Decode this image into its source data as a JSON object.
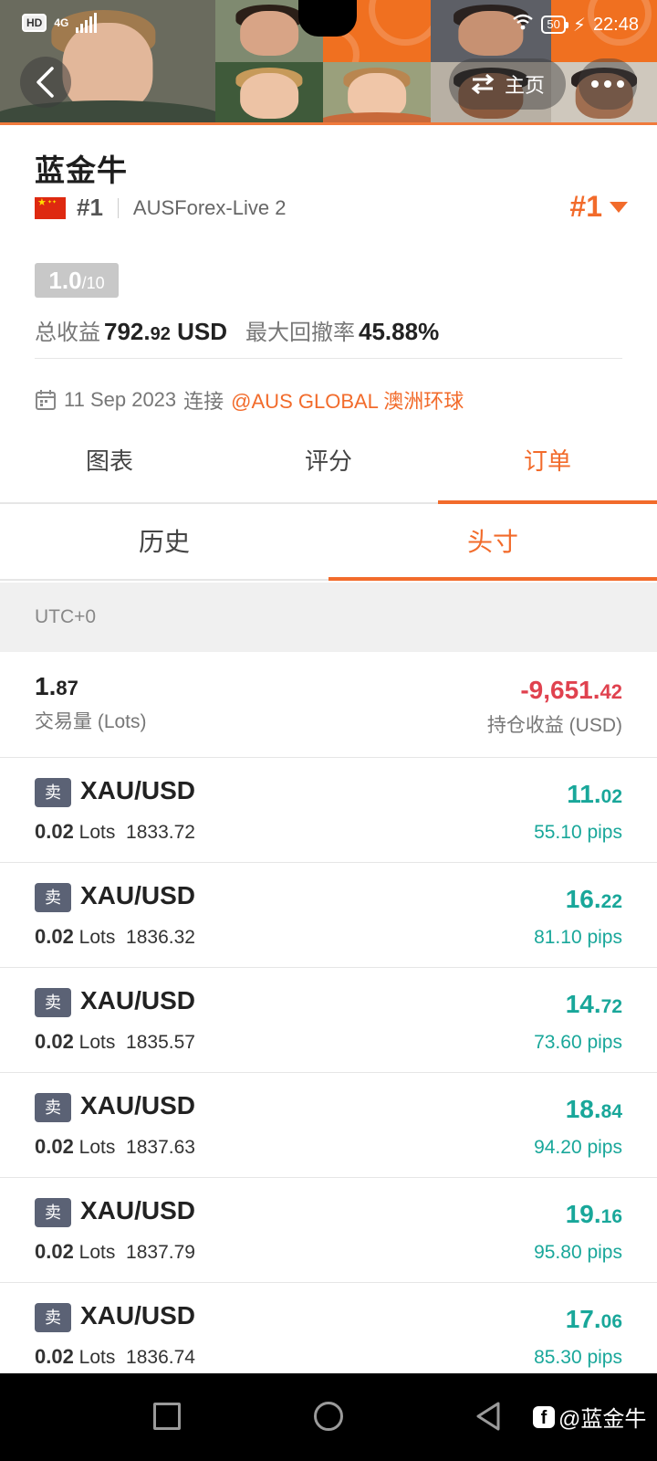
{
  "status_bar": {
    "hd": "HD",
    "network": "4G",
    "battery": "50",
    "time": "22:48"
  },
  "header": {
    "home_label": "主页"
  },
  "profile": {
    "name": "蓝金牛",
    "rank": "#1",
    "server": "AUSForex-Live 2",
    "rank_dropdown": "#1",
    "score_main": "1.0",
    "score_total": "/10",
    "total_profit_label": "总收益",
    "total_profit_int": "792.",
    "total_profit_dec": "92",
    "total_profit_unit": "USD",
    "max_drawdown_label": "最大回撤率",
    "max_drawdown": "45.88%",
    "connect_date": "11 Sep 2023",
    "connect_label": "连接",
    "broker": "@AUS GLOBAL 澳洲环球"
  },
  "tabs": [
    {
      "label": "图表"
    },
    {
      "label": "评分"
    },
    {
      "label": "订单"
    }
  ],
  "subtabs": [
    {
      "label": "历史"
    },
    {
      "label": "头寸"
    }
  ],
  "timezone": "UTC+0",
  "summary": {
    "volume_int": "1.",
    "volume_dec": "87",
    "volume_label": "交易量 (Lots)",
    "pl_int": "-9,651.",
    "pl_dec": "42",
    "pl_label": "持仓收益 (USD)"
  },
  "orders": [
    {
      "side": "卖",
      "symbol": "XAU/USD",
      "lots": "0.02",
      "lots_unit": "Lots",
      "price": "1833.72",
      "profit_int": "11.",
      "profit_dec": "02",
      "pips": "55.10 pips"
    },
    {
      "side": "卖",
      "symbol": "XAU/USD",
      "lots": "0.02",
      "lots_unit": "Lots",
      "price": "1836.32",
      "profit_int": "16.",
      "profit_dec": "22",
      "pips": "81.10 pips"
    },
    {
      "side": "卖",
      "symbol": "XAU/USD",
      "lots": "0.02",
      "lots_unit": "Lots",
      "price": "1835.57",
      "profit_int": "14.",
      "profit_dec": "72",
      "pips": "73.60 pips"
    },
    {
      "side": "卖",
      "symbol": "XAU/USD",
      "lots": "0.02",
      "lots_unit": "Lots",
      "price": "1837.63",
      "profit_int": "18.",
      "profit_dec": "84",
      "pips": "94.20 pips"
    },
    {
      "side": "卖",
      "symbol": "XAU/USD",
      "lots": "0.02",
      "lots_unit": "Lots",
      "price": "1837.79",
      "profit_int": "19.",
      "profit_dec": "16",
      "pips": "95.80 pips"
    },
    {
      "side": "卖",
      "symbol": "XAU/USD",
      "lots": "0.02",
      "lots_unit": "Lots",
      "price": "1836.74",
      "profit_int": "17.",
      "profit_dec": "06",
      "pips": "85.30 pips"
    }
  ],
  "watermark": "@蓝金牛",
  "colors": {
    "accent": "#f26b2b",
    "loss": "#e0424f",
    "gain": "#19a79a",
    "side_badge": "#5b6275"
  }
}
